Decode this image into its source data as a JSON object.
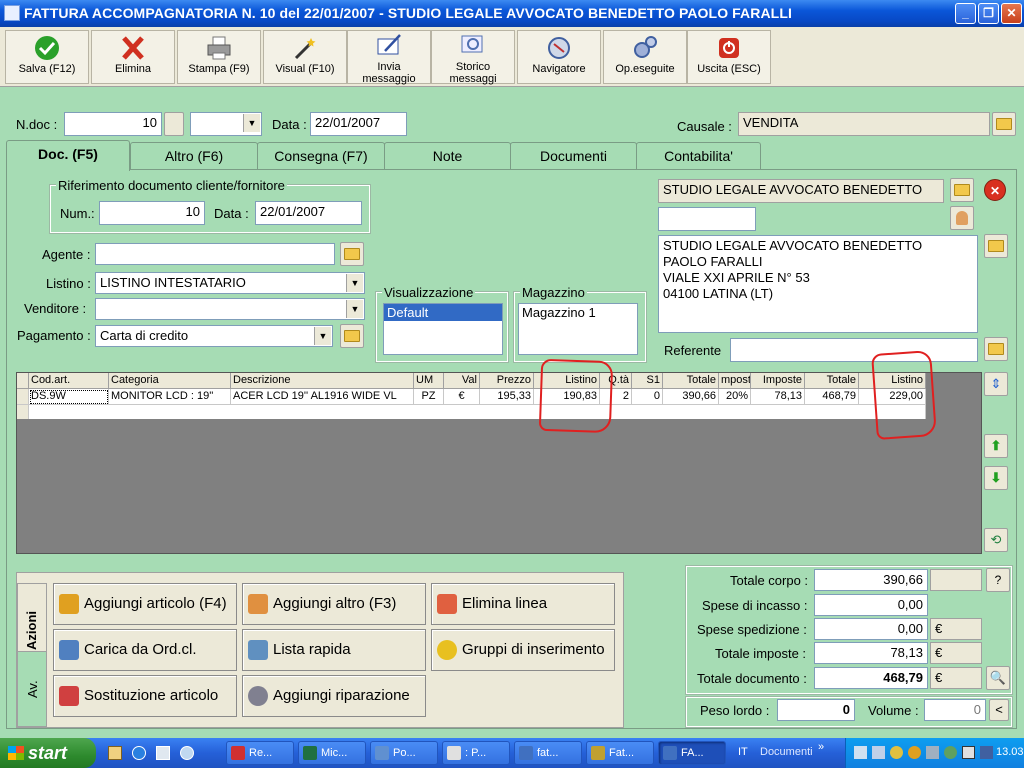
{
  "window": {
    "title": "FATTURA ACCOMPAGNATORIA N. 10  del 22/01/2007 - STUDIO LEGALE AVVOCATO BENEDETTO PAOLO FARALLI"
  },
  "toolbar": [
    {
      "label": "Salva (F12)",
      "icon": "check-icon",
      "color": "#2aa02a"
    },
    {
      "label": "Elimina",
      "icon": "x-icon",
      "color": "#d03020"
    },
    {
      "label": "Stampa (F9)",
      "icon": "printer-icon",
      "color": "#606060"
    },
    {
      "label": "Visual (F10)",
      "icon": "magic-wand-icon",
      "color": "#c09020"
    },
    {
      "label": "Invia messaggio",
      "icon": "pen-message-icon",
      "color": "#3050a0"
    },
    {
      "label": "Storico messaggi",
      "icon": "magnifier-icon",
      "color": "#5070b0"
    },
    {
      "label": "Navigatore",
      "icon": "compass-icon",
      "color": "#4060a0"
    },
    {
      "label": "Op.eseguite",
      "icon": "gears-icon",
      "color": "#6080c0"
    },
    {
      "label": "Uscita (ESC)",
      "icon": "power-icon",
      "color": "#d03020"
    }
  ],
  "header": {
    "ndoc_label": "N.doc :",
    "ndoc_value": "10",
    "data_label": "Data :",
    "data_value": "22/01/2007",
    "causale_label": "Causale :",
    "causale_value": "VENDITA"
  },
  "tabs": [
    "Doc. (F5)",
    "Altro (F6)",
    "Consegna (F7)",
    "Note",
    "Documenti",
    "Contabilita'"
  ],
  "riferimento": {
    "legend": "Riferimento documento cliente/fornitore",
    "num_label": "Num.:",
    "num_value": "10",
    "data_label": "Data :",
    "data_value": "22/01/2007"
  },
  "form": {
    "agente_label": "Agente :",
    "agente_value": "",
    "listino_label": "Listino :",
    "listino_value": "LISTINO INTESTATARIO",
    "venditore_label": "Venditore :",
    "venditore_value": "",
    "pagamento_label": "Pagamento :",
    "pagamento_value": "Carta di credito"
  },
  "visualizzazione": {
    "legend": "Visualizzazione",
    "selected": "Default"
  },
  "magazzino": {
    "legend": "Magazzino",
    "value": "Magazzino 1"
  },
  "cliente": {
    "name": "STUDIO LEGALE AVVOCATO BENEDETTO",
    "address_lines": [
      "STUDIO LEGALE AVVOCATO BENEDETTO",
      "PAOLO FARALLI",
      "VIALE XXI APRILE N° 53",
      "04100 LATINA (LT)"
    ],
    "referente_label": "Referente",
    "referente_value": ""
  },
  "grid": {
    "headers": [
      "Cod.art.",
      "Categoria",
      "Descrizione",
      "UM",
      "Val",
      "Prezzo",
      "Listino",
      "Q.tà",
      "S1",
      "Totale",
      "mpost",
      "Imposte",
      "Totale",
      "Listino"
    ],
    "rows": [
      [
        "DS.9W",
        "MONITOR LCD : 19''",
        "ACER LCD 19'' AL1916 WIDE VL",
        "PZ",
        "€",
        "195,33",
        "190,83",
        "2",
        "0",
        "390,66",
        "20%",
        "78,13",
        "468,79",
        "229,00"
      ]
    ]
  },
  "actions": {
    "side_tabs": [
      "Azioni",
      "Av."
    ],
    "buttons": [
      {
        "label": "Aggiungi articolo (F4)",
        "icon": "box-add-icon",
        "color": "#e0a020"
      },
      {
        "label": "Aggiungi altro (F3)",
        "icon": "grid-add-icon",
        "color": "#e09040"
      },
      {
        "label": "Elimina linea",
        "icon": "grid-delete-icon",
        "color": "#e06040"
      },
      {
        "label": "Carica da Ord.cl.",
        "icon": "clipboard-check-icon",
        "color": "#5080c0"
      },
      {
        "label": "Lista rapida",
        "icon": "list-add-icon",
        "color": "#6090c0"
      },
      {
        "label": "Gruppi di inserimento",
        "icon": "star-icon",
        "color": "#e8c020"
      },
      {
        "label": "Sostituzione articolo",
        "icon": "shapes-icon",
        "color": "#d04040"
      },
      {
        "label": "Aggiungi riparazione",
        "icon": "gear-icon",
        "color": "#808090"
      }
    ]
  },
  "totals": {
    "totale_corpo_label": "Totale corpo :",
    "totale_corpo": "390,66",
    "spese_incasso_label": "Spese di incasso :",
    "spese_incasso": "0,00",
    "spese_spedizione_label": "Spese spedizione :",
    "spese_spedizione": "0,00",
    "totale_imposte_label": "Totale imposte :",
    "totale_imposte": "78,13",
    "totale_documento_label": "Totale documento :",
    "totale_documento": "468,79",
    "currency": "€",
    "help": "?",
    "peso_label": "Peso lordo :",
    "peso_value": "0",
    "volume_label": "Volume :",
    "volume_value": "0",
    "collapse": "<"
  },
  "taskbar": {
    "start": "start",
    "tasks": [
      "Re...",
      "Mic...",
      "Po...",
      ": P...",
      "fat...",
      "Fat...",
      "FA..."
    ],
    "lang": "IT",
    "documenti": "Documenti",
    "time": "13.03"
  }
}
